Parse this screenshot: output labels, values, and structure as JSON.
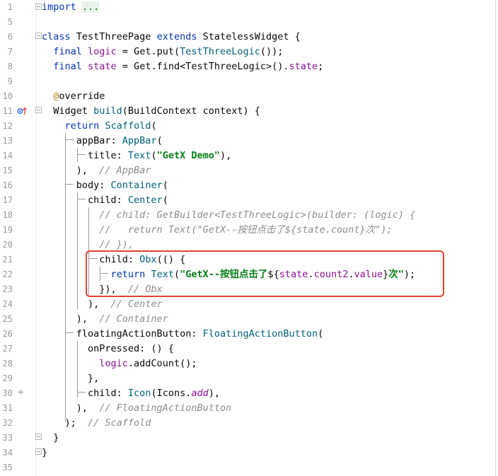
{
  "editor": {
    "lines": [
      {
        "num": "1",
        "tokens": [
          [
            "kw",
            "import"
          ],
          [
            "plain",
            " "
          ],
          [
            "fold",
            "..."
          ]
        ]
      },
      {
        "num": "5",
        "tokens": []
      },
      {
        "num": "6",
        "tokens": [
          [
            "kw",
            "class"
          ],
          [
            "plain",
            " TestThreePage "
          ],
          [
            "kw",
            "extends"
          ],
          [
            "plain",
            " StatelessWidget {"
          ]
        ]
      },
      {
        "num": "7",
        "tokens": [
          [
            "plain",
            "  "
          ],
          [
            "kw",
            "final"
          ],
          [
            "plain",
            " "
          ],
          [
            "fld",
            "logic"
          ],
          [
            "plain",
            " = Get.put("
          ],
          [
            "call",
            "TestThreeLogic"
          ],
          [
            "plain",
            "());"
          ]
        ]
      },
      {
        "num": "8",
        "tokens": [
          [
            "plain",
            "  "
          ],
          [
            "kw",
            "final"
          ],
          [
            "plain",
            " "
          ],
          [
            "fld",
            "state"
          ],
          [
            "plain",
            " = Get.find<TestThreeLogic>()."
          ],
          [
            "fld",
            "state"
          ],
          [
            "plain",
            ";"
          ]
        ]
      },
      {
        "num": "9",
        "tokens": []
      },
      {
        "num": "10",
        "tokens": [
          [
            "plain",
            "  "
          ],
          [
            "ann",
            "@"
          ],
          [
            "plain",
            "override"
          ]
        ]
      },
      {
        "num": "11",
        "tokens": [
          [
            "plain",
            "  Widget "
          ],
          [
            "nm",
            "build"
          ],
          [
            "plain",
            "(BuildContext context) {"
          ]
        ]
      },
      {
        "num": "12",
        "tokens": [
          [
            "plain",
            "    "
          ],
          [
            "kw",
            "return"
          ],
          [
            "plain",
            " "
          ],
          [
            "call",
            "Scaffold"
          ],
          [
            "plain",
            "("
          ]
        ]
      },
      {
        "num": "13",
        "tokens": [
          [
            "plain",
            "      appBar: "
          ],
          [
            "call",
            "AppBar"
          ],
          [
            "plain",
            "("
          ]
        ]
      },
      {
        "num": "14",
        "tokens": [
          [
            "plain",
            "        title: "
          ],
          [
            "call",
            "Text"
          ],
          [
            "plain",
            "("
          ],
          [
            "str",
            "\"GetX Demo\""
          ],
          [
            "plain",
            "),"
          ]
        ]
      },
      {
        "num": "15",
        "tokens": [
          [
            "plain",
            "      ),  "
          ],
          [
            "cm",
            "// AppBar"
          ]
        ]
      },
      {
        "num": "16",
        "tokens": [
          [
            "plain",
            "      body: "
          ],
          [
            "call",
            "Container"
          ],
          [
            "plain",
            "("
          ]
        ]
      },
      {
        "num": "17",
        "tokens": [
          [
            "plain",
            "        child: "
          ],
          [
            "call",
            "Center"
          ],
          [
            "plain",
            "("
          ]
        ]
      },
      {
        "num": "18",
        "tokens": [
          [
            "plain",
            "          "
          ],
          [
            "cm",
            "// child: GetBuilder<TestThreeLogic>(builder: (logic) {"
          ]
        ]
      },
      {
        "num": "19",
        "tokens": [
          [
            "plain",
            "          "
          ],
          [
            "cm",
            "//   return Text(\"GetX--按钮点击了${state.count}次\");"
          ]
        ]
      },
      {
        "num": "20",
        "tokens": [
          [
            "plain",
            "          "
          ],
          [
            "cm",
            "// }),"
          ]
        ]
      },
      {
        "num": "21",
        "tokens": [
          [
            "plain",
            "          child: "
          ],
          [
            "call",
            "Obx"
          ],
          [
            "plain",
            "(() {"
          ]
        ]
      },
      {
        "num": "22",
        "tokens": [
          [
            "plain",
            "            "
          ],
          [
            "kw",
            "return"
          ],
          [
            "plain",
            " "
          ],
          [
            "call",
            "Text"
          ],
          [
            "plain",
            "("
          ],
          [
            "str",
            "\"GetX--按钮点击了"
          ],
          [
            "plain",
            "${"
          ],
          [
            "fld",
            "state"
          ],
          [
            "plain",
            "."
          ],
          [
            "fld",
            "count2"
          ],
          [
            "plain",
            "."
          ],
          [
            "fld",
            "value"
          ],
          [
            "plain",
            "}"
          ],
          [
            "str",
            "次\""
          ],
          [
            "plain",
            ");"
          ]
        ]
      },
      {
        "num": "23",
        "tokens": [
          [
            "plain",
            "          }),  "
          ],
          [
            "cm",
            "// Obx"
          ]
        ]
      },
      {
        "num": "24",
        "tokens": [
          [
            "plain",
            "        ),  "
          ],
          [
            "cm",
            "// Center"
          ]
        ]
      },
      {
        "num": "25",
        "tokens": [
          [
            "plain",
            "      ),  "
          ],
          [
            "cm",
            "// Container"
          ]
        ]
      },
      {
        "num": "26",
        "tokens": [
          [
            "plain",
            "      floatingActionButton: "
          ],
          [
            "call",
            "FloatingActionButton"
          ],
          [
            "plain",
            "("
          ]
        ]
      },
      {
        "num": "27",
        "tokens": [
          [
            "plain",
            "        onPressed: () {"
          ]
        ]
      },
      {
        "num": "28",
        "tokens": [
          [
            "plain",
            "          "
          ],
          [
            "fld",
            "logic"
          ],
          [
            "plain",
            ".addCount();"
          ]
        ]
      },
      {
        "num": "29",
        "tokens": [
          [
            "plain",
            "        },"
          ]
        ]
      },
      {
        "num": "30",
        "tokens": [
          [
            "plain",
            "        child: "
          ],
          [
            "call",
            "Icon"
          ],
          [
            "plain",
            "(Icons."
          ],
          [
            "it",
            "add"
          ],
          [
            "plain",
            "),"
          ]
        ]
      },
      {
        "num": "31",
        "tokens": [
          [
            "plain",
            "      ),  "
          ],
          [
            "cm",
            "// FloatingActionButton"
          ]
        ]
      },
      {
        "num": "32",
        "tokens": [
          [
            "plain",
            "    );  "
          ],
          [
            "cm",
            "// Scaffold"
          ]
        ]
      },
      {
        "num": "33",
        "tokens": [
          [
            "plain",
            "  }"
          ]
        ]
      },
      {
        "num": "34",
        "tokens": [
          [
            "plain",
            "}"
          ]
        ]
      },
      {
        "num": "35",
        "tokens": []
      }
    ]
  },
  "icons": {
    "override": "override-implements-icon",
    "add": "add-line-icon"
  },
  "colors": {
    "keyword": "#0033b3",
    "string": "#067d17",
    "comment": "#8c8c8c",
    "highlight_box": "#e2432f"
  }
}
